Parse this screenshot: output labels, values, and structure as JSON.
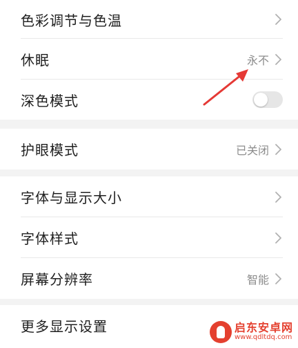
{
  "settings": {
    "group1": [
      {
        "label": "色彩调节与色温",
        "value": ""
      },
      {
        "label": "休眠",
        "value": "永不"
      },
      {
        "label": "深色模式",
        "toggle_on": false
      }
    ],
    "group2": [
      {
        "label": "护眼模式",
        "value": "已关闭"
      }
    ],
    "group3": [
      {
        "label": "字体与显示大小",
        "value": ""
      },
      {
        "label": "字体样式",
        "value": ""
      },
      {
        "label": "屏幕分辨率",
        "value": "智能"
      }
    ],
    "group4": [
      {
        "label": "更多显示设置",
        "value": ""
      }
    ]
  },
  "annotation": {
    "color": "#e53935",
    "icon": "red-arrow-icon"
  },
  "watermark": {
    "title": "启东安卓网",
    "url": "www.qdltdq.com",
    "accent": "#e4402f"
  }
}
